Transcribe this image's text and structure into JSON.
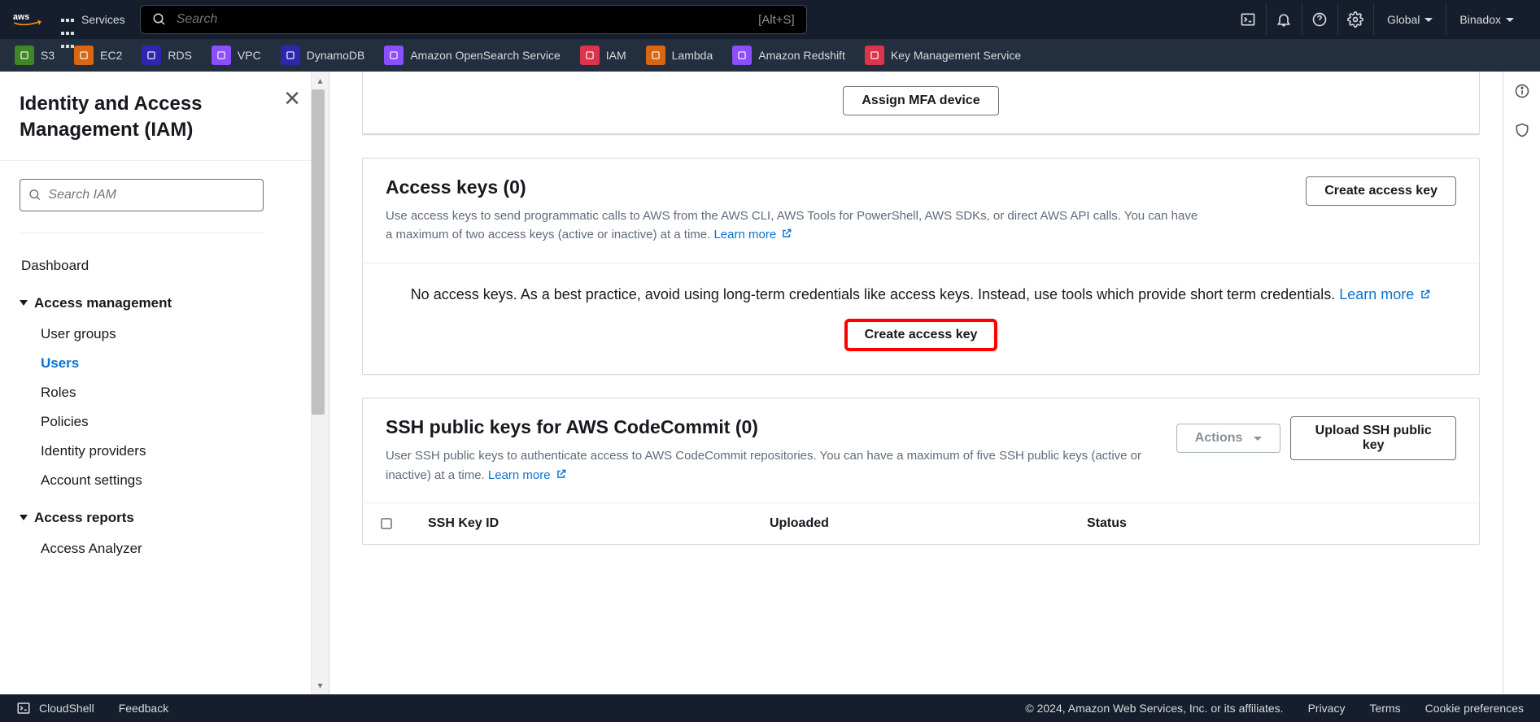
{
  "header": {
    "services_label": "Services",
    "search_placeholder": "Search",
    "search_shortcut": "[Alt+S]",
    "region": "Global",
    "account": "Binadox"
  },
  "service_shortcuts": [
    {
      "label": "S3",
      "color": "#3f8624"
    },
    {
      "label": "EC2",
      "color": "#d86613"
    },
    {
      "label": "RDS",
      "color": "#2e27ad"
    },
    {
      "label": "VPC",
      "color": "#8c4fff"
    },
    {
      "label": "DynamoDB",
      "color": "#2e27ad"
    },
    {
      "label": "Amazon OpenSearch Service",
      "color": "#8c4fff"
    },
    {
      "label": "IAM",
      "color": "#dd344c"
    },
    {
      "label": "Lambda",
      "color": "#d86613"
    },
    {
      "label": "Amazon Redshift",
      "color": "#8c4fff"
    },
    {
      "label": "Key Management Service",
      "color": "#dd344c"
    }
  ],
  "sidebar": {
    "title": "Identity and Access Management (IAM)",
    "search_placeholder": "Search IAM",
    "dashboard": "Dashboard",
    "sections": {
      "access_mgmt": {
        "label": "Access management",
        "items": [
          "User groups",
          "Users",
          "Roles",
          "Policies",
          "Identity providers",
          "Account settings"
        ]
      },
      "access_reports": {
        "label": "Access reports",
        "items": [
          "Access Analyzer"
        ]
      }
    }
  },
  "mfa": {
    "assign_btn": "Assign MFA device"
  },
  "access_keys": {
    "title": "Access keys (0)",
    "create_btn": "Create access key",
    "desc_part1": "Use access keys to send programmatic calls to AWS from the AWS CLI, AWS Tools for PowerShell, AWS SDKs, or direct AWS API calls. You can have a maximum of two access keys (active or inactive) at a time. ",
    "learn_more": "Learn more",
    "empty_part1": "No access keys. As a best practice, avoid using long-term credentials like access keys. Instead, use tools which provide short term credentials. ",
    "empty_create_btn": "Create access key"
  },
  "ssh": {
    "title": "SSH public keys for AWS CodeCommit (0)",
    "actions_btn": "Actions",
    "upload_btn": "Upload SSH public key",
    "desc": "User SSH public keys to authenticate access to AWS CodeCommit repositories. You can have a maximum of five SSH public keys (active or inactive) at a time. ",
    "learn_more": "Learn more",
    "columns": [
      "SSH Key ID",
      "Uploaded",
      "Status"
    ]
  },
  "footer": {
    "cloudshell": "CloudShell",
    "feedback": "Feedback",
    "copyright": "© 2024, Amazon Web Services, Inc. or its affiliates.",
    "links": [
      "Privacy",
      "Terms",
      "Cookie preferences"
    ]
  }
}
